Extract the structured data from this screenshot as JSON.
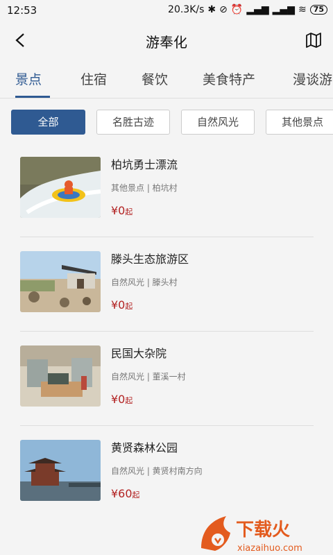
{
  "status": {
    "time": "12:53",
    "speed": "20.3K/s",
    "battery": "75"
  },
  "header": {
    "title": "游奉化"
  },
  "tabs": [
    {
      "label": "景点",
      "active": true
    },
    {
      "label": "住宿"
    },
    {
      "label": "餐饮"
    },
    {
      "label": "美食特产"
    },
    {
      "label": "漫谈游"
    }
  ],
  "filters": [
    {
      "label": "全部",
      "active": true
    },
    {
      "label": "名胜古迹"
    },
    {
      "label": "自然风光"
    },
    {
      "label": "其他景点"
    }
  ],
  "items": [
    {
      "name": "柏坑勇士漂流",
      "meta": "其他景点 | 柏坑村",
      "price": "¥0",
      "suffix": "起"
    },
    {
      "name": "滕头生态旅游区",
      "meta": "自然风光 | 滕头村",
      "price": "¥0",
      "suffix": "起"
    },
    {
      "name": "民国大杂院",
      "meta": "自然风光 | 董溪一村",
      "price": "¥0",
      "suffix": "起"
    },
    {
      "name": "黄贤森林公园",
      "meta": "自然风光 | 黄贤村南方向",
      "price": "¥60",
      "suffix": "起"
    }
  ],
  "watermark": {
    "text": "下载火",
    "url": "xiazaihuo.com"
  }
}
